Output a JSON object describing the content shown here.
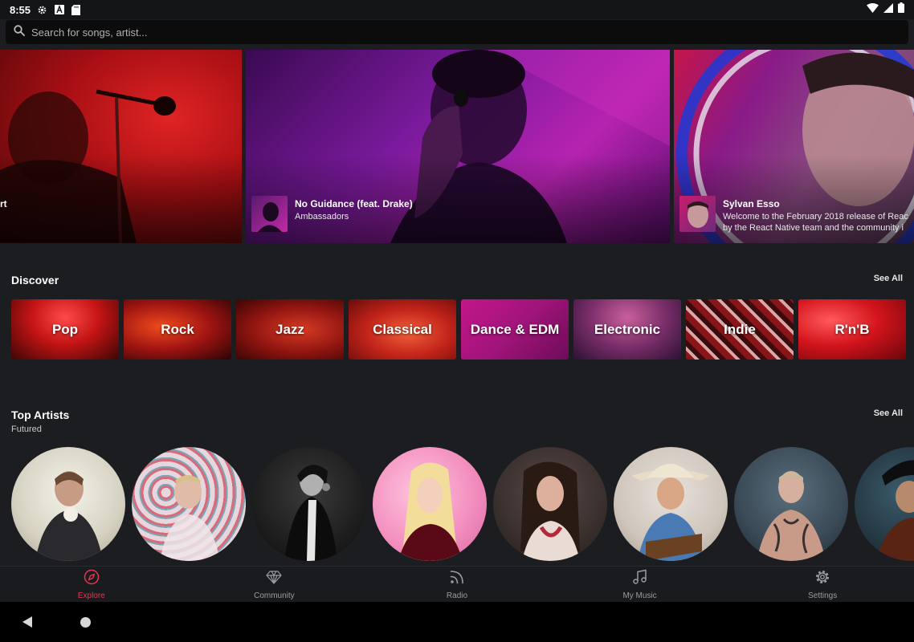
{
  "status_bar": {
    "time": "8:55",
    "icons": [
      "gear-icon",
      "a-box-icon",
      "sd-card-icon",
      "wifi-icon",
      "signal-icon",
      "battery-icon"
    ]
  },
  "search": {
    "placeholder": "Search for songs, artist...",
    "value": ""
  },
  "featured": [
    {
      "title_fragment": "rt"
    },
    {
      "title": "No Guidance (feat. Drake)",
      "subtitle": "Ambassadors"
    },
    {
      "title": "Sylvan Esso",
      "subtitle": "Welcome to the February 2018 release of Reac",
      "subtitle2": "by the React Native team and the community i"
    }
  ],
  "discover": {
    "title": "Discover",
    "see_all": "See All",
    "genres": [
      "Pop",
      "Rock",
      "Jazz",
      "Classical",
      "Dance & EDM",
      "Electronic",
      "Indie",
      "R'n'B"
    ]
  },
  "top_artists": {
    "title": "Top Artists",
    "subtitle": "Futured",
    "see_all": "See All"
  },
  "tabs": [
    {
      "label": "Explore",
      "icon": "compass-icon",
      "active": true
    },
    {
      "label": "Community",
      "icon": "diamond-icon",
      "active": false
    },
    {
      "label": "Radio",
      "icon": "radio-signal-icon",
      "active": false
    },
    {
      "label": "My Music",
      "icon": "music-note-icon",
      "active": false
    },
    {
      "label": "Settings",
      "icon": "gear-icon",
      "active": false
    }
  ],
  "colors": {
    "accent": "#e4364f",
    "background": "#1c1d20",
    "search_bg": "#0c0c0d",
    "tab_inactive": "#9a9ca0"
  }
}
